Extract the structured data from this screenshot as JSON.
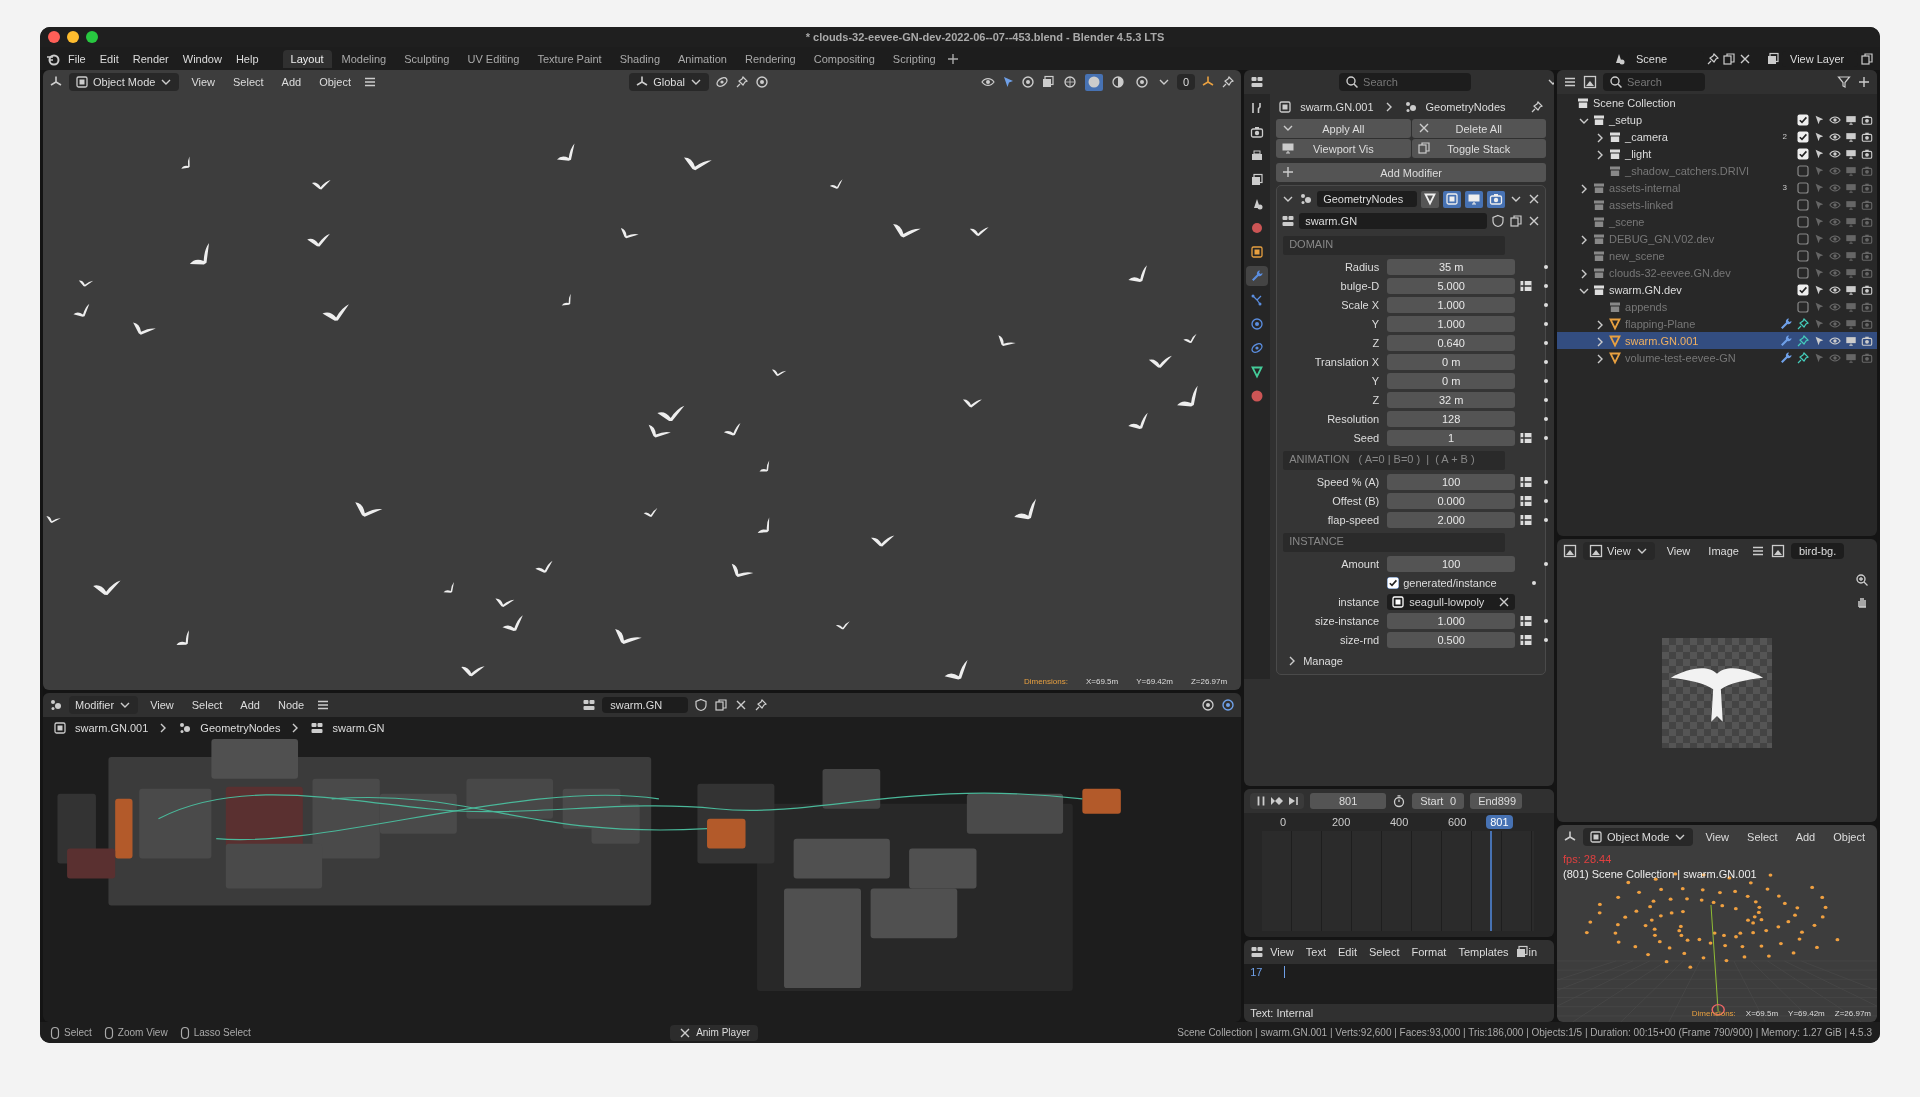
{
  "window": {
    "title": "* clouds-32-eevee-GN-dev-2022-06--07--453.blend - Blender 4.5.3 LTS"
  },
  "menu": [
    "File",
    "Edit",
    "Render",
    "Window",
    "Help"
  ],
  "workspaces": [
    {
      "label": "Layout",
      "selected": true
    },
    {
      "label": "Modeling",
      "selected": false
    },
    {
      "label": "Sculpting",
      "selected": false
    },
    {
      "label": "UV Editing",
      "selected": false
    },
    {
      "label": "Texture Paint",
      "selected": false
    },
    {
      "label": "Shading",
      "selected": false
    },
    {
      "label": "Animation",
      "selected": false
    },
    {
      "label": "Rendering",
      "selected": false
    },
    {
      "label": "Compositing",
      "selected": false
    },
    {
      "label": "Scripting",
      "selected": false
    }
  ],
  "scene": "Scene",
  "view_layer": "View Layer",
  "viewport": {
    "mode": "Object Mode",
    "menus": [
      "View",
      "Select",
      "Add",
      "Object"
    ],
    "orientation": "Global",
    "overlay_count": "0",
    "shading": [
      {
        "kind": "wireframe",
        "selected": false
      },
      {
        "kind": "solid",
        "selected": true
      },
      {
        "kind": "material",
        "selected": false
      },
      {
        "kind": "rendered",
        "selected": false
      }
    ],
    "dimensions": {
      "label": "Dimensions:",
      "values": [
        "X=69.5m",
        "Y=69.42m",
        "Z=26.97m"
      ]
    }
  },
  "node_editor": {
    "editor": "Modifier",
    "menus": [
      "View",
      "Select",
      "Add",
      "Node"
    ],
    "node_group": "swarm.GN",
    "breadcrumb": [
      "swarm.GN.001",
      "GeometryNodes",
      "swarm.GN"
    ]
  },
  "properties": {
    "search_placeholder": "Search",
    "tabs": [
      {
        "kind": "tool",
        "selected": false
      },
      {
        "kind": "render",
        "selected": false
      },
      {
        "kind": "output",
        "selected": false
      },
      {
        "kind": "view_layer",
        "selected": false
      },
      {
        "kind": "scene",
        "selected": false
      },
      {
        "kind": "world",
        "selected": false
      },
      {
        "kind": "object",
        "selected": false
      },
      {
        "kind": "modifier",
        "selected": true
      },
      {
        "kind": "particles",
        "selected": false
      },
      {
        "kind": "physics",
        "selected": false
      },
      {
        "kind": "constraints",
        "selected": false
      },
      {
        "kind": "data",
        "selected": false
      },
      {
        "kind": "material",
        "selected": false
      }
    ],
    "breadcrumb": [
      "swarm.GN.001",
      "GeometryNodes"
    ],
    "buttons": [
      {
        "kind": "apply",
        "label": "Apply All"
      },
      {
        "kind": "delete",
        "label": "Delete All"
      },
      {
        "kind": "viewport",
        "label": "Viewport Vis"
      },
      {
        "kind": "toggle",
        "label": "Toggle Stack"
      }
    ],
    "add_modifier": "Add Modifier"
  },
  "modifier": {
    "name": "GeometryNodes",
    "expanded": true,
    "toggles": [
      {
        "kind": "on_cage",
        "on": false
      },
      {
        "kind": "edit_mode",
        "on": true
      },
      {
        "kind": "viewport",
        "on": true
      },
      {
        "kind": "render",
        "on": true
      }
    ],
    "node_group": "swarm.GN",
    "sections": [
      {
        "title": "DOMAIN",
        "rows": [
          {
            "kind": "field",
            "label": "Radius",
            "value": "35 m",
            "attribute": false
          },
          {
            "kind": "field",
            "label": "bulge-D",
            "value": "5.000",
            "attribute": true
          },
          {
            "kind": "field",
            "label": "Scale X",
            "value": "1.000",
            "attribute": false
          },
          {
            "kind": "field",
            "label": "Y",
            "value": "1.000",
            "attribute": false
          },
          {
            "kind": "field",
            "label": "Z",
            "value": "0.640",
            "attribute": false
          },
          {
            "kind": "field",
            "label": "Translation X",
            "value": "0 m",
            "attribute": false
          },
          {
            "kind": "field",
            "label": "Y",
            "value": "0 m",
            "attribute": false
          },
          {
            "kind": "field",
            "label": "Z",
            "value": "32 m",
            "attribute": false
          },
          {
            "kind": "field",
            "label": "Resolution",
            "value": "128",
            "attribute": false
          },
          {
            "kind": "field",
            "label": "Seed",
            "value": "1",
            "attribute": true
          }
        ]
      },
      {
        "title": "ANIMATION   ( A=0 | B=0 )  |  ( A + B )",
        "rows": [
          {
            "kind": "field",
            "label": "Speed % (A)",
            "value": "100",
            "attribute": true
          },
          {
            "kind": "field",
            "label": "Offest (B)",
            "value": "0.000",
            "attribute": true
          },
          {
            "kind": "field",
            "label": "flap-speed",
            "value": "2.000",
            "attribute": true
          }
        ]
      },
      {
        "title": "INSTANCE",
        "rows": [
          {
            "kind": "field",
            "label": "Amount",
            "value": "100",
            "attribute": false
          },
          {
            "kind": "check",
            "label": "generated/instance",
            "checked": true
          },
          {
            "kind": "object",
            "label": "instance",
            "value": "seagull-lowpoly"
          },
          {
            "kind": "field",
            "label": "size-instance",
            "value": "1.000",
            "attribute": true
          },
          {
            "kind": "field",
            "label": "size-rnd",
            "value": "0.500",
            "attribute": true
          }
        ]
      }
    ],
    "manage": {
      "label": "Manage",
      "expanded": false
    }
  },
  "timeline": {
    "frame": "801",
    "start_label": "Start",
    "start": "0",
    "end_label": "End",
    "end": "899",
    "ticks": [
      "0",
      "200",
      "400",
      "600"
    ],
    "current": "801"
  },
  "text_editor": {
    "menus": [
      "View",
      "Text",
      "Edit",
      "Select",
      "Format",
      "Templates"
    ],
    "cut_label": "in",
    "line": "17",
    "footer": "Text: Internal"
  },
  "outliner": {
    "search_placeholder": "Search",
    "tree": [
      {
        "label": "Scene Collection",
        "kind": "root",
        "selected": false,
        "children": [
          {
            "label": "_setup",
            "kind": "collection",
            "expanded": true,
            "checked": true,
            "selected": false,
            "children": [
              {
                "label": "_camera",
                "kind": "collection",
                "expanded": false,
                "checked": true,
                "selected": false,
                "badge": "2"
              },
              {
                "label": "_light",
                "kind": "collection",
                "expanded": false,
                "checked": true,
                "selected": false
              },
              {
                "label": "_shadow_catchers.DRIVI",
                "kind": "collection",
                "checked": false,
                "selected": false
              }
            ]
          },
          {
            "label": "assets-internal",
            "kind": "collection",
            "expanded": false,
            "checked": false,
            "selected": false,
            "badge": "3"
          },
          {
            "label": "assets-linked",
            "kind": "collection",
            "checked": false,
            "selected": false
          },
          {
            "label": "_scene",
            "kind": "collection",
            "checked": false,
            "selected": false
          },
          {
            "label": "DEBUG_GN.V02.dev",
            "kind": "collection",
            "expanded": false,
            "checked": false,
            "selected": false
          },
          {
            "label": "new_scene",
            "kind": "collection",
            "checked": false,
            "selected": false
          },
          {
            "label": "clouds-32-eevee.GN.dev",
            "kind": "collection",
            "expanded": false,
            "checked": false,
            "selected": false
          },
          {
            "label": "swarm.GN.dev",
            "kind": "collection",
            "expanded": true,
            "checked": true,
            "selected": false,
            "children": [
              {
                "label": "appends",
                "kind": "collection",
                "checked": false,
                "selected": false
              },
              {
                "label": "flapping-Plane",
                "kind": "object",
                "expanded": false,
                "enabled": false,
                "selected": false
              },
              {
                "label": "swarm.GN.001",
                "kind": "object",
                "expanded": false,
                "enabled": true,
                "selected": true
              },
              {
                "label": "volume-test-eevee-GN",
                "kind": "object",
                "expanded": false,
                "enabled": false,
                "selected": false
              }
            ]
          }
        ]
      }
    ]
  },
  "image_editor": {
    "view_mode": "View",
    "menus": [
      "View",
      "Image"
    ],
    "image_name": "bird-bg."
  },
  "preview": {
    "mode": "Object Mode",
    "menus": [
      "View",
      "Select",
      "Add",
      "Object"
    ],
    "fps": "fps: 28.44",
    "info": "(801) Scene Collection | swarm.GN.001",
    "dimensions": {
      "label": "Dimensions:",
      "values": [
        "X=69.5m",
        "Y=69.42m",
        "Z=26.97m"
      ]
    }
  },
  "status_bar": {
    "hints": [
      "Select",
      "Zoom View",
      "Lasso Select"
    ],
    "center": "Anim Player",
    "stats": "Scene Collection | swarm.GN.001 | Verts:92,600 | Faces:93,000 | Tris:186,000 | Objects:1/5 | Duration: 00:15+00 (Frame 790/900) | Memory: 1.27 GiB | 4.5.3"
  }
}
